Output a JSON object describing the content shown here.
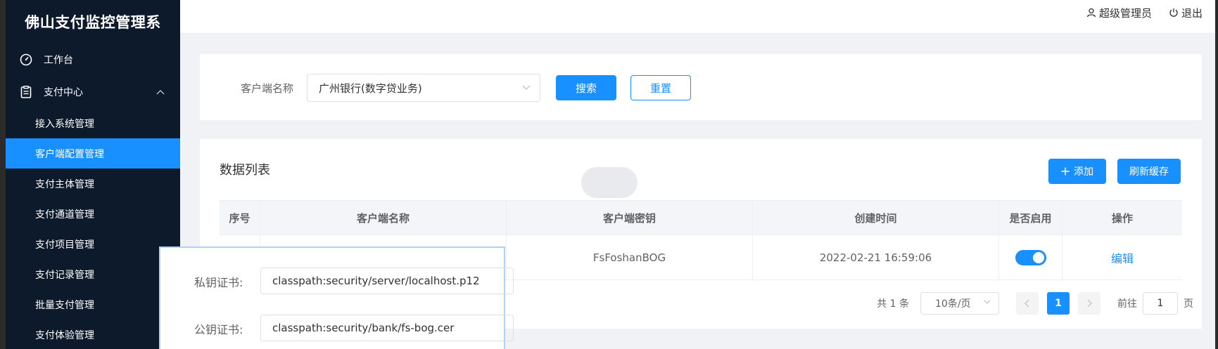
{
  "app": {
    "title": "佛山支付监控管理系"
  },
  "header": {
    "user": "超级管理员",
    "logout": "退出"
  },
  "sidebar": {
    "workbench": "工作台",
    "pay_center": "支付中心",
    "items": [
      {
        "label": "接入系统管理"
      },
      {
        "label": "客户端配置管理"
      },
      {
        "label": "支付主体管理"
      },
      {
        "label": "支付通道管理"
      },
      {
        "label": "支付项目管理"
      },
      {
        "label": "支付记录管理"
      },
      {
        "label": "批量支付管理"
      },
      {
        "label": "支付体验管理"
      }
    ]
  },
  "search": {
    "label": "客户端名称",
    "selected": "广州银行(数字贷业务)",
    "search_btn": "搜索",
    "reset_btn": "重置"
  },
  "list": {
    "title": "数据列表",
    "add_btn": "添加",
    "refresh_btn": "刷新缓存",
    "columns": [
      "序号",
      "客户端名称",
      "客户端密钥",
      "创建时间",
      "是否启用",
      "操作"
    ],
    "rows": [
      {
        "key": "FsFoshanBOG",
        "created": "2022-02-21 16:59:06",
        "enabled": true,
        "action": "编辑"
      }
    ]
  },
  "pager": {
    "total": "共 1 条",
    "size": "10条/页",
    "page": "1",
    "goto_prefix": "前往",
    "goto_value": "1",
    "goto_suffix": "页"
  },
  "overlay": {
    "private_label": "私钥证书:",
    "private_value": "classpath:security/server/localhost.p12",
    "public_label": "公钥证书:",
    "public_value": "classpath:security/bank/fs-bog.cer"
  },
  "colors": {
    "primary": "#1890ff",
    "sidebar": "#0d1a2b"
  }
}
